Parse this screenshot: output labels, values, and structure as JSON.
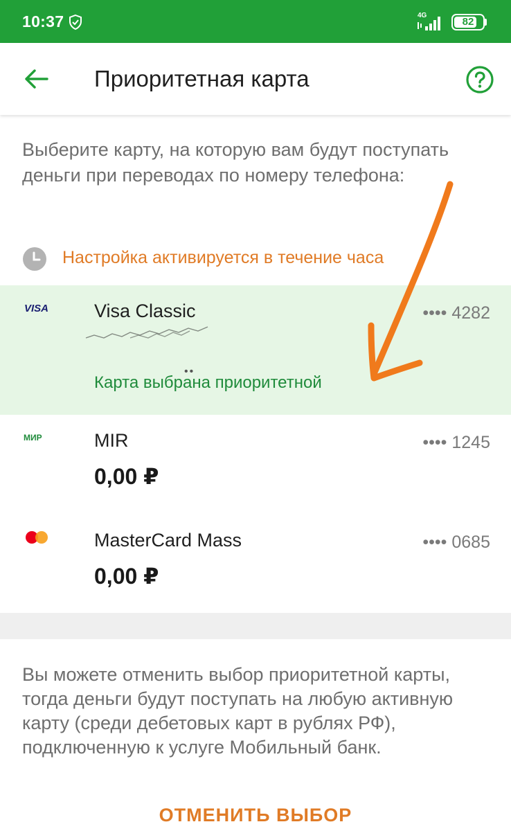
{
  "status_bar": {
    "time": "10:37",
    "network": "4G",
    "battery": "82",
    "battery_level": 0.82,
    "bg_color": "#21a038"
  },
  "header": {
    "title": "Приоритетная карта",
    "back_icon": "arrow-left-icon",
    "help_icon": "help-circle-icon",
    "accent_color": "#21a038"
  },
  "intro_text": "Выберите карту, на которую вам будут поступать деньги при переводах по номеру телефона:",
  "notice": {
    "icon": "clock-icon",
    "text": "Настройка активируется в течение часа",
    "color": "#e07b26"
  },
  "cards": [
    {
      "brand": "VISA",
      "name": "Visa Classic",
      "number": "•••• 4282",
      "status": "Карта выбрана приоритетной",
      "selected": true
    },
    {
      "brand": "МИР",
      "name": "MIR",
      "number": "•••• 1245",
      "balance": "0,00 ₽",
      "selected": false
    },
    {
      "brand": "mastercard",
      "name": "MasterCard Mass",
      "number": "•••• 0685",
      "balance": "0,00 ₽",
      "selected": false
    }
  ],
  "footer_text": "Вы можете отменить выбор приоритетной карты, тогда деньги будут поступать на любую активную карту (среди дебетовых карт в рублях РФ), подключенную к услуге Мобильный банк.",
  "cancel_button": "ОТМЕНИТЬ ВЫБОР"
}
